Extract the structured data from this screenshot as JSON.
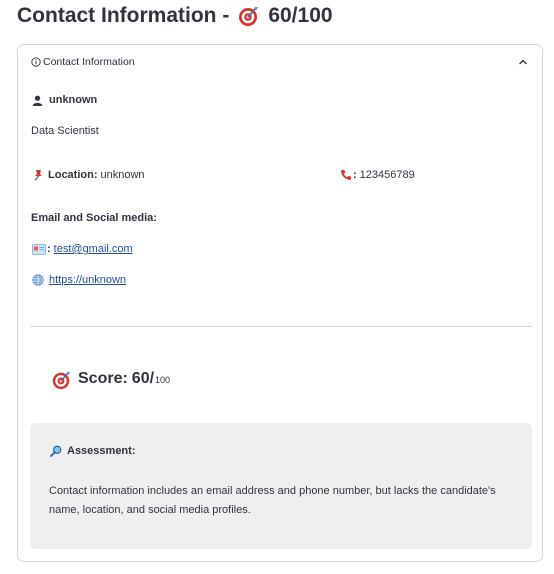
{
  "page": {
    "title": "Contact Information -",
    "score_text": "60/100",
    "title_icon": "target-icon"
  },
  "expander": {
    "header_label": "Contact Information",
    "header_icon": "info-icon",
    "toggle_icon": "chevron-up-icon"
  },
  "contact": {
    "name": "unknown",
    "name_icon": "person-icon",
    "role": "Data Scientist",
    "location_label": "Location:",
    "location_value": "unknown",
    "location_icon": "pushpin-icon",
    "phone_sep": ":",
    "phone": "123456789",
    "phone_icon": "phone-icon",
    "email_social_heading": "Email and Social media:",
    "email_sep": ":",
    "email": "test@gmail.com",
    "email_icon": "email-icon",
    "website": "https://unknown",
    "website_icon": "globe-icon"
  },
  "score": {
    "label": "Score:",
    "value": "60/",
    "max": "100",
    "icon": "target-icon"
  },
  "assessment": {
    "title": "Assessment:",
    "icon": "magnifier-icon",
    "text": "Contact information includes an email address and phone number, but lacks the candidate's name, location, and social media profiles."
  },
  "colors": {
    "text": "#31333f",
    "link": "#1f4e9c",
    "border": "#d6d6d9",
    "assessment_bg": "#efefef",
    "target_red": "#e0312b",
    "phone_red": "#d9352d"
  }
}
